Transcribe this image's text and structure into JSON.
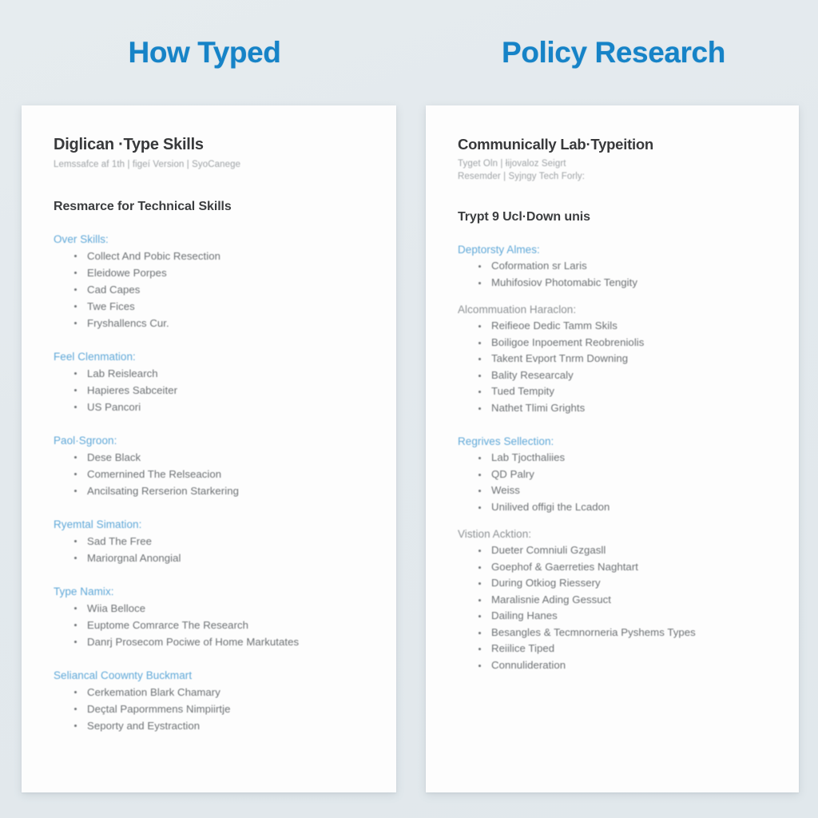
{
  "columns": [
    {
      "heading": "How Typed",
      "doc": {
        "title": "Diglican ·Type Skills",
        "meta_lines": [
          "Lemssafce af 1th | figeí Version | SyoCanege"
        ],
        "section_title": "Resmarce for Technical Skills",
        "groups": [
          {
            "label": "Over Skills:",
            "label_color": "blue",
            "items": [
              "Collect And Pobic Resection",
              "Eleidowe Porpes",
              "Cad Capes",
              "Twe Fices",
              "Fryshallencs Cur."
            ]
          },
          {
            "label": "Feel Clenmation:",
            "label_color": "blue",
            "items": [
              "Lab Reislearch",
              "Hapieres Sabceiter",
              "US Pancori"
            ]
          },
          {
            "label": "Paol·Sgroon:",
            "label_color": "blue",
            "items": [
              "Dese Black",
              "Comernined The Relseacion",
              "Ancilsating Rerserion Starkering"
            ]
          },
          {
            "label": "Ryemtal Simation:",
            "label_color": "blue",
            "items": [
              "Sad The Free",
              "Mariorgnal Anongial"
            ]
          },
          {
            "label": "Type Namix:",
            "label_color": "blue",
            "items": [
              "Wiia Belloce",
              "Euptome Comrarce The Research",
              "Danrj Prosecom Pociwe of Home Markutates"
            ]
          },
          {
            "label": "Seliancal Coownty Buckmart",
            "label_color": "blue",
            "items": [
              "Cerkemation Blark Chamary",
              "Deçtal Papormmens Nimpiirtje",
              "Seporty and Eystraction"
            ]
          }
        ]
      }
    },
    {
      "heading": "Policy Research",
      "doc": {
        "title": "Communically Lab·Typeition",
        "meta_lines": [
          "Tyget Oln | łijovaloz Seigrt",
          "Resemder | Syjngy Tech Forly:"
        ],
        "section_title": "Trypt 9 Ucl·Down unis",
        "groups": [
          {
            "label": "Deptorsty Almes:",
            "label_color": "blue",
            "items": [
              "Coformation sr Laris",
              "Muhifosiov Photomabic Tengity"
            ]
          },
          {
            "label": "Alcommuation Haraclon:",
            "label_color": "gray",
            "items": [
              "Reifieoe Dedic Tamm Skils",
              "Boiligoe Inpoement Reobreniolis",
              "Takent Evport Tnrm Downing",
              "Bality Researcaly",
              "Tued Tempity",
              "Nathet Tlimi Grights"
            ]
          },
          {
            "label": "Regrives Sellection:",
            "label_color": "blue",
            "items": [
              "Lab Tjocthaliies",
              "QD Palry",
              "Weiss",
              "Unilived offigi the Lcadon"
            ]
          },
          {
            "label": "Vistion Acktion:",
            "label_color": "gray",
            "items": [
              "Dueter Comniuli Gzgasll",
              "Goephof & Gaerreties Naghtart",
              "During Otkiog Riessery",
              "Maralisnie Ading Gessuct",
              "Dailing Hanes",
              "Besangles & Tecmnorneria Pyshems Types",
              "Reiilice Tiped",
              "Connulideration"
            ]
          }
        ]
      }
    }
  ],
  "colors": {
    "accent_heading": "#1683c7",
    "group_label_blue": "#5fa8d8",
    "group_label_gray": "#8d9194",
    "body_text": "#6d7174",
    "title_text": "#38393b",
    "page_background": "#e4eaee",
    "card_background": "#fdfdfd"
  }
}
